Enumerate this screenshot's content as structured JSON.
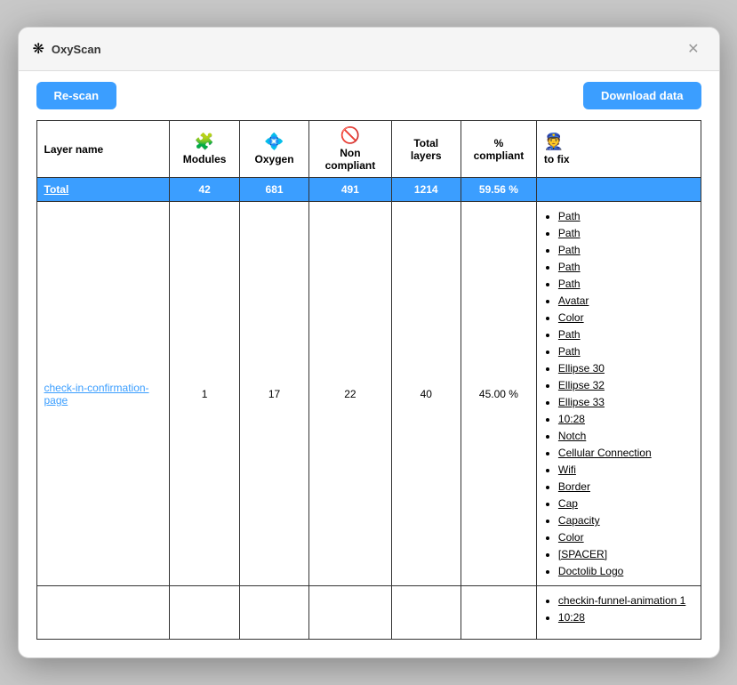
{
  "window": {
    "title": "OxyScan",
    "icon": "❋"
  },
  "toolbar": {
    "rescan_label": "Re-scan",
    "download_label": "Download data"
  },
  "table": {
    "headers": {
      "layer_name": "Layer name",
      "modules_icon": "🧩",
      "modules_label": "Modules",
      "oxygen_icon": "💠",
      "oxygen_label": "Oxygen",
      "non_compliant_icon": "🚫",
      "non_compliant_label": "Non compliant",
      "total_layers_label": "Total layers",
      "compliant_label": "% compliant",
      "to_fix_icon": "👮",
      "to_fix_label": "to fix"
    },
    "total_row": {
      "layer_name": "Total",
      "modules": "42",
      "oxygen": "681",
      "non_compliant": "491",
      "total_layers": "1214",
      "compliant": "59.56 %",
      "to_fix": []
    },
    "rows": [
      {
        "layer_name": "check-in-confirmation-page",
        "modules": "1",
        "oxygen": "17",
        "non_compliant": "22",
        "total_layers": "40",
        "compliant": "45.00 %",
        "to_fix": [
          "Path",
          "Path",
          "Path",
          "Path",
          "Path",
          "Avatar",
          "Color",
          "Path",
          "Path",
          "Ellipse 30",
          "Ellipse 32",
          "Ellipse 33",
          "10:28",
          "Notch",
          "Cellular Connection",
          "Wifi",
          "Border",
          "Cap",
          "Capacity",
          "Color",
          "[SPACER]",
          "Doctolib Logo"
        ]
      },
      {
        "layer_name": "",
        "modules": "",
        "oxygen": "",
        "non_compliant": "",
        "total_layers": "",
        "compliant": "",
        "to_fix": [
          "checkin-funnel-animation 1",
          "10:28"
        ]
      }
    ]
  }
}
